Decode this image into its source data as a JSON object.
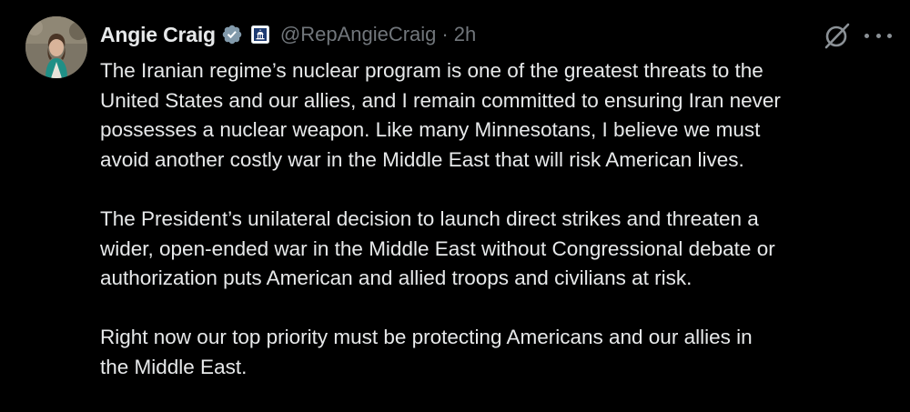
{
  "author": {
    "display_name": "Angie Craig",
    "handle": "@RepAngieCraig",
    "separator": "·",
    "time": "2h",
    "verified_color": "#829aab",
    "avatar_icon": "profile-photo"
  },
  "actions": {
    "grok_icon": "grok-icon",
    "more_icon": "more-icon"
  },
  "tweet": {
    "paragraphs": [
      {
        "lines": [
          "The Iranian regime’s nuclear program is one of the greatest threats to the",
          "United States and our allies, and I remain committed to ensuring Iran never",
          "possesses a nuclear weapon. Like many Minnesotans, I believe we must",
          "avoid another costly war in the Middle East that will risk American lives."
        ]
      },
      {
        "lines": [
          "The President’s unilateral decision to launch direct strikes and threaten a",
          "wider, open-ended war in the Middle East without Congressional debate or",
          "authorization puts American and allied troops and civilians at risk."
        ]
      },
      {
        "lines": [
          "Right now our top priority must be protecting Americans and our allies in",
          "the Middle East."
        ]
      }
    ]
  },
  "colors": {
    "background": "#000000",
    "text": "#e7e9ea",
    "secondary": "#71767b"
  }
}
